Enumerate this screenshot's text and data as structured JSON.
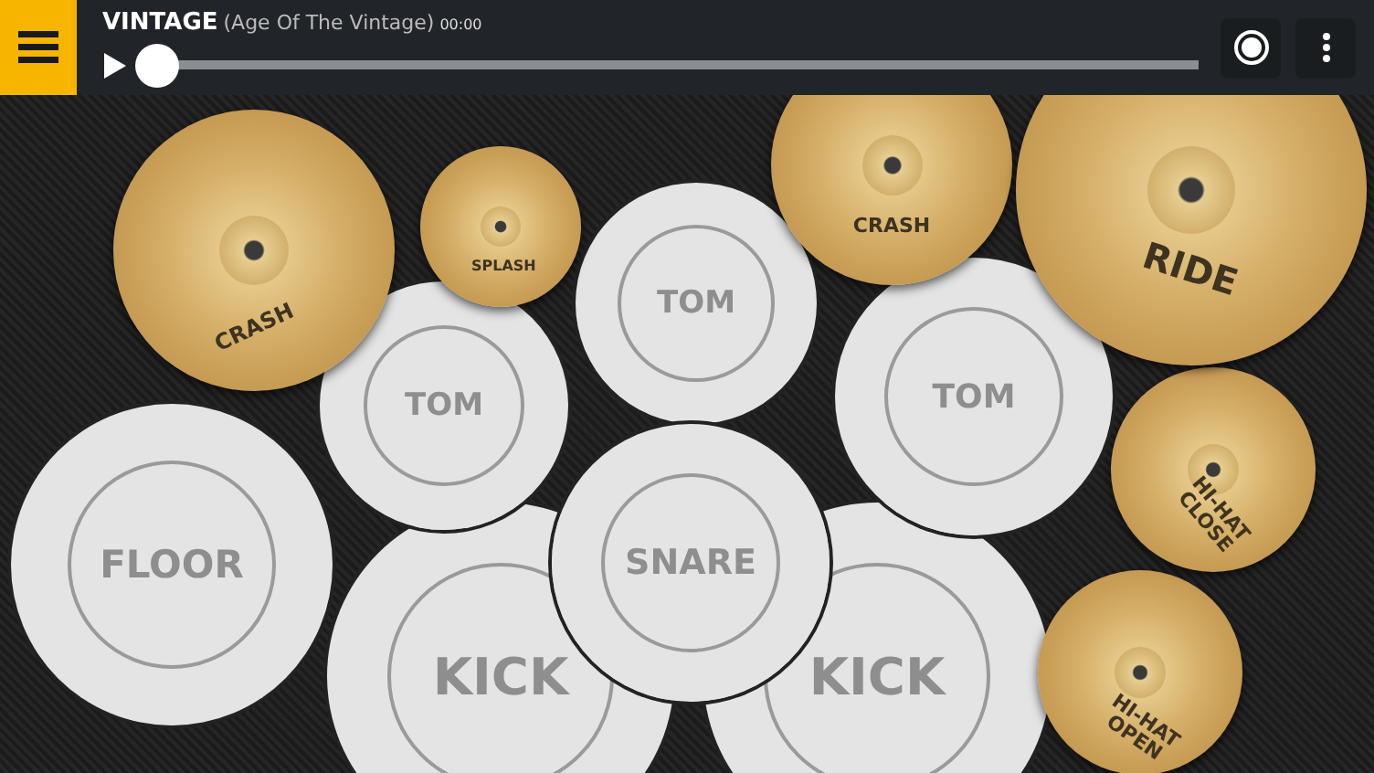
{
  "track": {
    "title": "VINTAGE",
    "subtitle": "(Age Of The Vintage)",
    "time": "00:00"
  },
  "progress": {
    "level": 0
  },
  "pads": [
    {
      "kind": "drum",
      "label": "KICK"
    },
    {
      "kind": "drum",
      "label": "KICK"
    },
    {
      "kind": "drum",
      "label": "FLOOR"
    },
    {
      "kind": "drum",
      "label": "TOM"
    },
    {
      "kind": "drum",
      "label": "TOM"
    },
    {
      "kind": "drum",
      "label": "TOM"
    },
    {
      "kind": "drum",
      "label": "SNARE"
    },
    {
      "kind": "cymbal",
      "label": "CRASH"
    },
    {
      "kind": "cymbal",
      "label": "SPLASH"
    },
    {
      "kind": "cymbal",
      "label": "CRASH"
    },
    {
      "kind": "cymbal",
      "label": "HI-HAT OPEN"
    },
    {
      "kind": "cymbal",
      "label": "HI-HAT CLOSE"
    },
    {
      "kind": "cymbal",
      "label": "RIDE"
    }
  ]
}
